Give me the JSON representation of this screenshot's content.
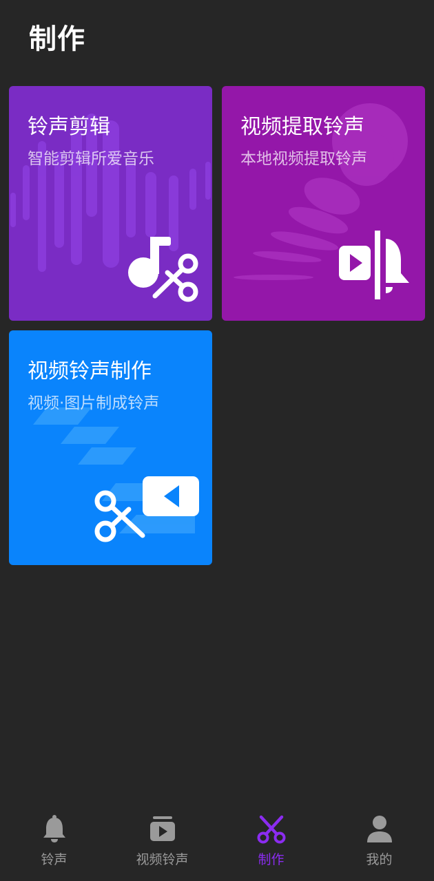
{
  "header": {
    "title": "制作"
  },
  "cards": [
    {
      "title": "铃声剪辑",
      "subtitle": "智能剪辑所爱音乐",
      "icon": "music-scissors-icon",
      "color": "#7a2cc4"
    },
    {
      "title": "视频提取铃声",
      "subtitle": "本地视频提取铃声",
      "icon": "video-bell-icon",
      "color": "#9417a9"
    },
    {
      "title": "视频铃声制作",
      "subtitle": "视频·图片制成铃声",
      "icon": "scissors-video-icon",
      "color": "#0a84fc"
    }
  ],
  "nav": {
    "items": [
      {
        "label": "铃声",
        "icon": "bell-icon"
      },
      {
        "label": "视频铃声",
        "icon": "video-play-icon"
      },
      {
        "label": "制作",
        "icon": "scissors-icon",
        "active": true
      },
      {
        "label": "我的",
        "icon": "person-icon"
      }
    ],
    "active_color": "#8b2cf0",
    "inactive_color": "#9a9a9a"
  }
}
